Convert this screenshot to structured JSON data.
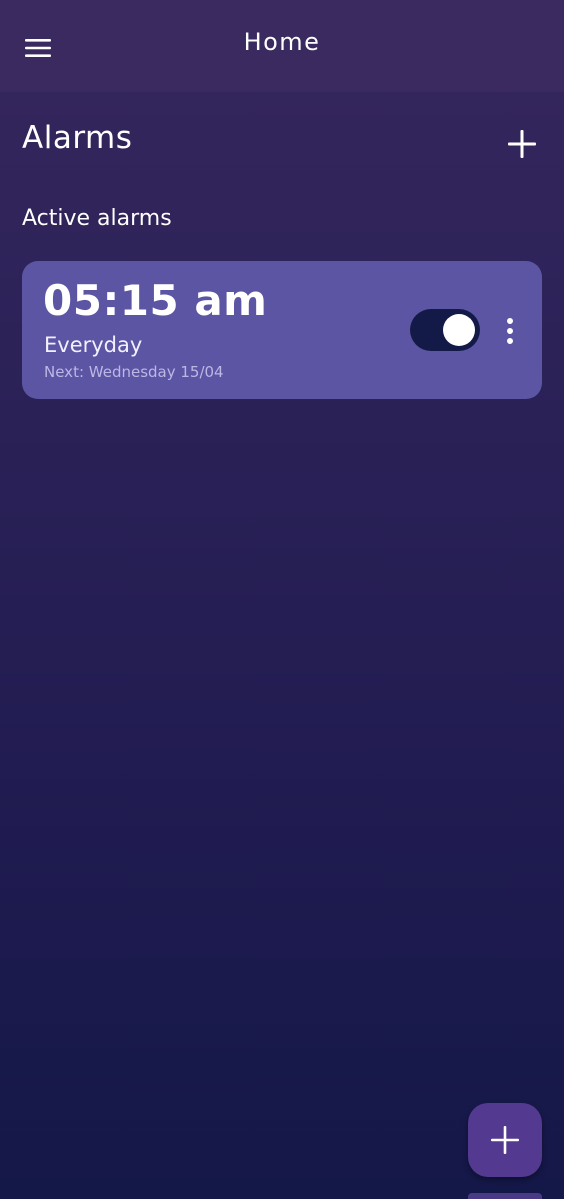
{
  "app_bar": {
    "title": "Home",
    "menu_icon": "hamburger-menu-icon"
  },
  "section": {
    "title": "Alarms",
    "add_icon": "plus-icon",
    "subtitle": "Active alarms"
  },
  "alarms": [
    {
      "time": "05:15 am",
      "repeat": "Everyday",
      "next": "Next: Wednesday 15/04",
      "enabled": true,
      "more_icon": "more-vert-icon"
    }
  ],
  "fab": {
    "icon": "plus-icon"
  },
  "colors": {
    "app_bar": "#3a2a5f",
    "background_top": "#36275e",
    "background_bottom": "#141848",
    "card": "#5c55a3",
    "toggle_track": "#141a47",
    "fab": "#53398f"
  }
}
